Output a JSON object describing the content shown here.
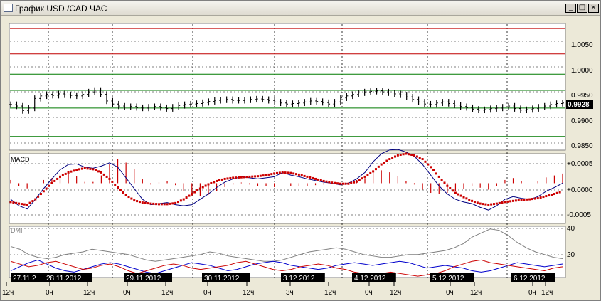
{
  "window": {
    "title": "График USD /CAD  ЧАС",
    "buttons": {
      "minimize": "_",
      "maximize": "□",
      "close": "×"
    }
  },
  "price_panel": {
    "y_axis_labels": [
      "1.0050",
      "1.0000",
      "0.9950",
      "0.9900",
      "0.9850"
    ],
    "current_price": "0.9928",
    "h_lines": [
      {
        "price": 1.0075,
        "color": "#c00000"
      },
      {
        "price": 1.0025,
        "color": "#c00000"
      },
      {
        "price": 0.9985,
        "color": "#007a00"
      },
      {
        "price": 0.9953,
        "color": "#007a00"
      },
      {
        "price": 0.9918,
        "color": "#007a00"
      },
      {
        "price": 0.9862,
        "color": "#007a00"
      }
    ]
  },
  "macd_panel": {
    "label": "MACD",
    "y_axis_labels": [
      "+0.0005",
      "+0.0000",
      "-0.0005"
    ]
  },
  "dmi_panel": {
    "label": "DMI",
    "y_axis_labels": [
      "40",
      "20"
    ]
  },
  "date_labels": [
    "27.11.2",
    "28.11.2012",
    "29.11.2012",
    "30.11.2012",
    "3.12.2012",
    "4.12.2012",
    "5.12.2012",
    "6.12.2012"
  ],
  "hour_labels": [
    "12ч",
    "0ч",
    "12ч",
    "0ч",
    "12ч",
    "0ч",
    "12ч",
    "3ч",
    "12ч",
    "0ч",
    "12ч",
    "0ч",
    "12ч",
    "0ч",
    "12ч"
  ],
  "colors": {
    "background": "#ffffff",
    "price_bars": "#000000",
    "macd_line": "#000080",
    "macd_signal": "#cc0000",
    "macd_hist": "#cc0000",
    "dmi_adx": "#808080",
    "dmi_plus": "#0000cc",
    "dmi_minus": "#cc0000"
  },
  "chart_data": {
    "type": "line",
    "title": "",
    "price_series": {
      "values": [
        0.9925,
        0.9922,
        0.9913,
        0.9918,
        0.9937,
        0.9942,
        0.9945,
        0.9943,
        0.9946,
        0.9944,
        0.9943,
        0.9942,
        0.9945,
        0.995,
        0.9953,
        0.9945,
        0.9932,
        0.9926,
        0.9922,
        0.992,
        0.9921,
        0.9919,
        0.9918,
        0.992,
        0.9921,
        0.9919,
        0.9917,
        0.992,
        0.9923,
        0.9925,
        0.9926,
        0.9927,
        0.9929,
        0.9931,
        0.9933,
        0.9934,
        0.9935,
        0.9933,
        0.9933,
        0.9934,
        0.9935,
        0.9936,
        0.9935,
        0.9933,
        0.993,
        0.9928,
        0.9926,
        0.9927,
        0.9928,
        0.993,
        0.9932,
        0.9931,
        0.9929,
        0.9926,
        0.993,
        0.9938,
        0.9942,
        0.9945,
        0.9948,
        0.995,
        0.9951,
        0.9952,
        0.995,
        0.9948,
        0.9946,
        0.9944,
        0.994,
        0.9935,
        0.993,
        0.9926,
        0.9925,
        0.9928,
        0.993,
        0.9927,
        0.9924,
        0.9921,
        0.9919,
        0.9916,
        0.9914,
        0.9915,
        0.9917,
        0.9918,
        0.992,
        0.9922,
        0.9917,
        0.9914,
        0.9915,
        0.9917,
        0.992,
        0.9922,
        0.9925,
        0.9927,
        0.9928
      ],
      "ylim": [
        0.9835,
        1.0085
      ]
    },
    "macd_series": {
      "macd": [
        -0.0003,
        -0.00042,
        -0.00048,
        -0.0003,
        -0.0001,
        8e-05,
        0.00025,
        0.00035,
        0.00036,
        0.0003,
        0.00028,
        0.00032,
        0.00038,
        0.0003,
        0.0001,
        -0.0001,
        -0.0003,
        -0.0004,
        -0.00038,
        -0.00036,
        -0.0004,
        -0.00042,
        -0.0004,
        -0.0003,
        -0.0002,
        -8e-05,
        2e-05,
        8e-05,
        0.00012,
        0.0001,
        8e-05,
        0.0001,
        0.00012,
        0.0002,
        0.00015,
        0.00012,
        8e-05,
        5e-05,
        2e-05,
        0.0,
        -3e-05,
        0.0,
        8e-05,
        0.0002,
        0.0004,
        0.00055,
        0.00062,
        0.00063,
        0.00058,
        0.0005,
        0.00035,
        0.00015,
        -5e-05,
        -0.0002,
        -0.0003,
        -0.00035,
        -0.00038,
        -0.00045,
        -0.0005,
        -0.00042,
        -0.0003,
        -0.00025,
        -0.00028,
        -0.0003,
        -0.00025,
        -0.00015,
        -8e-05,
        0.0
      ],
      "signal": [
        -0.00035,
        -0.00038,
        -0.0004,
        -0.0003,
        -0.00015,
        0.0,
        0.00012,
        0.0002,
        0.00025,
        0.00028,
        0.00026,
        0.0002,
        8e-05,
        -8e-05,
        -0.00022,
        -0.00032,
        -0.00036,
        -0.00038,
        -0.00039,
        -0.00039,
        -0.00037,
        -0.0003,
        -0.0002,
        -0.0001,
        -2e-05,
        4e-05,
        8e-05,
        0.0001,
        0.00011,
        0.00012,
        0.00013,
        0.00015,
        0.00018,
        0.0002,
        0.00019,
        0.00016,
        0.00012,
        8e-05,
        4e-05,
        1e-05,
        -1e-05,
        -1e-05,
        3e-05,
        0.00012,
        0.00022,
        0.00035,
        0.00045,
        0.00052,
        0.00055,
        0.00052,
        0.00045,
        0.0003,
        0.00012,
        -5e-05,
        -0.00018,
        -0.00026,
        -0.00033,
        -0.00038,
        -0.0004,
        -0.00038,
        -0.00035,
        -0.00033,
        -0.00031,
        -0.0003,
        -0.00028,
        -0.00024,
        -0.0002,
        -0.00015
      ],
      "ylim": [
        -0.00075,
        0.00055
      ]
    },
    "dmi_series": {
      "adx": [
        28,
        26,
        22,
        20,
        19,
        20,
        22,
        23,
        24,
        26,
        25,
        24,
        23,
        22,
        20,
        18,
        17,
        18,
        19,
        20,
        21,
        22,
        24,
        23,
        21,
        20,
        19,
        18,
        17,
        17,
        18,
        20,
        22,
        24,
        25,
        26,
        27,
        26,
        24,
        22,
        21,
        20,
        20,
        21,
        22,
        22,
        23,
        24,
        25,
        27,
        30,
        35,
        38,
        41,
        40,
        36,
        31,
        27,
        24,
        22,
        20,
        19
      ],
      "plus_di": [
        10,
        13,
        16,
        18,
        15,
        12,
        10,
        9,
        11,
        13,
        15,
        16,
        15,
        13,
        11,
        9,
        8,
        10,
        12,
        14,
        16,
        15,
        14,
        12,
        10,
        11,
        13,
        15,
        16,
        17,
        16,
        14,
        13,
        12,
        11,
        12,
        14,
        15,
        16,
        15,
        14,
        15,
        16,
        17,
        16,
        14,
        12,
        13,
        14,
        13,
        12,
        10,
        9,
        10,
        12,
        14,
        16,
        15,
        14,
        13,
        14,
        15
      ],
      "minus_di": [
        17,
        15,
        13,
        14,
        16,
        17,
        15,
        13,
        11,
        12,
        14,
        15,
        13,
        10,
        8,
        10,
        12,
        14,
        15,
        14,
        12,
        11,
        12,
        13,
        14,
        16,
        17,
        15,
        13,
        11,
        10,
        11,
        13,
        14,
        15,
        14,
        12,
        11,
        9,
        8,
        7,
        8,
        9,
        8,
        7,
        6,
        7,
        8,
        10,
        13,
        15,
        17,
        18,
        16,
        15,
        14,
        13,
        12,
        11,
        10,
        12,
        13
      ],
      "ylim": [
        5,
        43
      ]
    }
  }
}
